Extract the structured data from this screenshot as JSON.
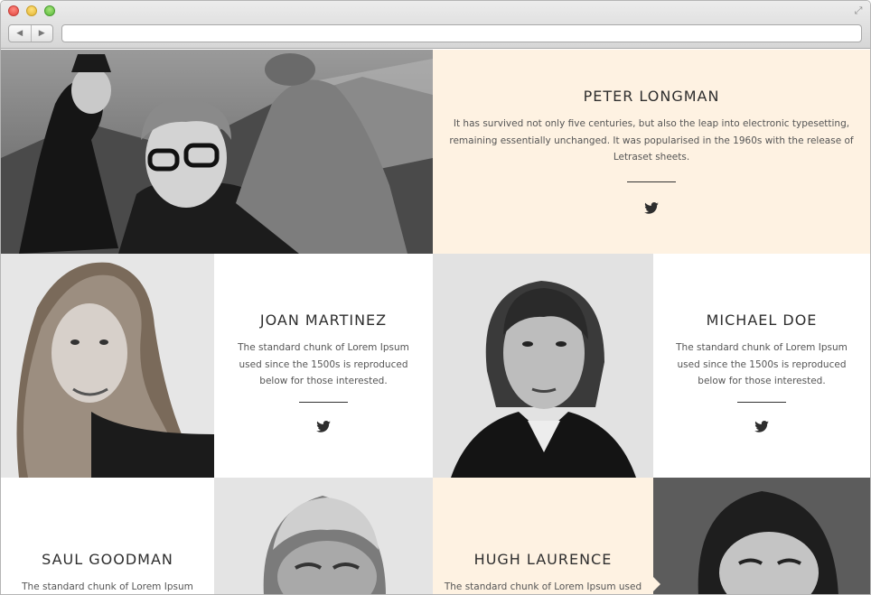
{
  "browser": {
    "url_value": "",
    "back_label": "◀",
    "forward_label": "▶"
  },
  "team": [
    {
      "name": "PETER LONGMAN",
      "bio_lines": [
        "It has survived not only five centuries, but also the leap into electronic typesetting,",
        "remaining essentially unchanged. It was popularised in the 1960s with the release of",
        "Letraset sheets."
      ]
    },
    {
      "name": "JOAN MARTINEZ",
      "bio_lines": [
        "The standard chunk of Lorem Ipsum",
        "used since the 1500s is reproduced",
        "below for those interested."
      ]
    },
    {
      "name": "MICHAEL DOE",
      "bio_lines": [
        "The standard chunk of Lorem Ipsum",
        "used since the 1500s is reproduced",
        "below for those interested."
      ]
    },
    {
      "name": "SAUL GOODMAN",
      "bio_lines": [
        "The standard chunk of Lorem Ipsum"
      ]
    },
    {
      "name": "HUGH LAURENCE",
      "bio_lines": [
        "The standard chunk of Lorem Ipsum used"
      ]
    }
  ],
  "colors": {
    "cream": "#fef2e2",
    "white": "#ffffff",
    "text_dark": "#2e2e2e",
    "text_body": "#555555"
  },
  "icons": {
    "social": "twitter-icon"
  }
}
